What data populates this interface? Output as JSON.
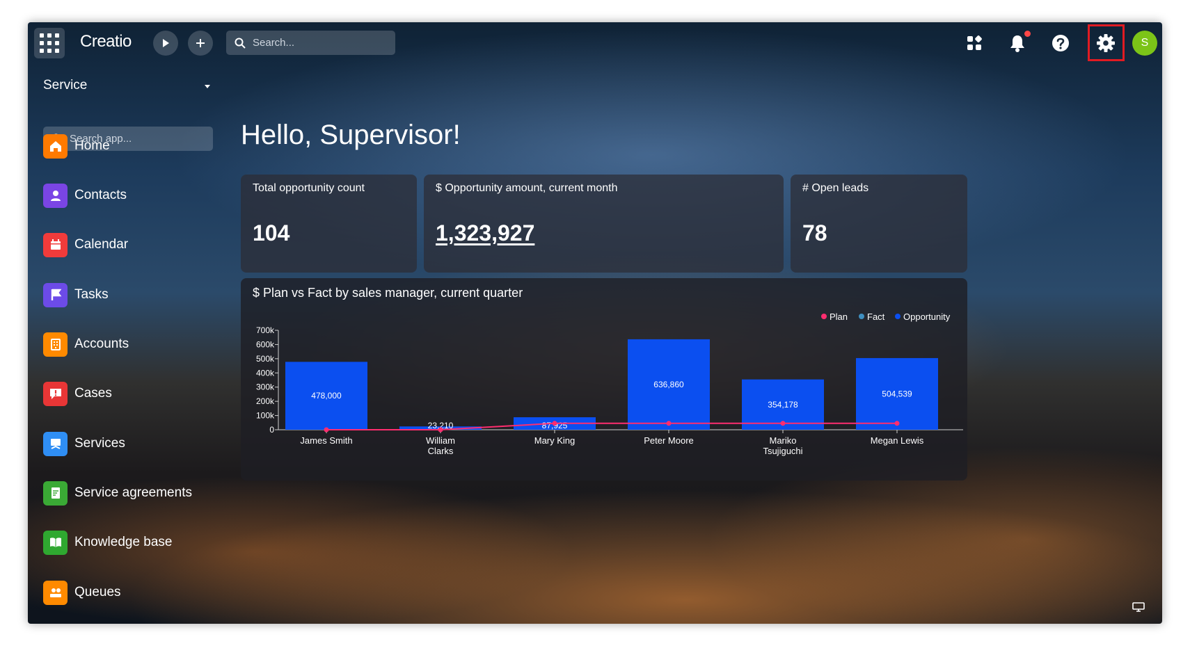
{
  "topbar": {
    "logo": "Creatio",
    "search_placeholder": "Search...",
    "avatar_initial": "S"
  },
  "sidebar": {
    "workspace": "Service",
    "search_placeholder": "Search app...",
    "items": [
      {
        "label": "Home",
        "icon": "home-icon",
        "color": "#ff7a00"
      },
      {
        "label": "Contacts",
        "icon": "person-icon",
        "color": "#7a45e5"
      },
      {
        "label": "Calendar",
        "icon": "calendar-icon",
        "color": "#f13b3b"
      },
      {
        "label": "Tasks",
        "icon": "flag-icon",
        "color": "#6c4be8"
      },
      {
        "label": "Accounts",
        "icon": "building-icon",
        "color": "#ff8a00"
      },
      {
        "label": "Cases",
        "icon": "case-alert-icon",
        "color": "#e83636"
      },
      {
        "label": "Services",
        "icon": "service-icon",
        "color": "#2f8ef4"
      },
      {
        "label": "Service agreements",
        "icon": "agreement-icon",
        "color": "#3aa935"
      },
      {
        "label": "Knowledge base",
        "icon": "book-icon",
        "color": "#2fa830"
      },
      {
        "label": "Queues",
        "icon": "queue-icon",
        "color": "#ff8a00"
      }
    ]
  },
  "main": {
    "greeting": "Hello, Supervisor!",
    "cards": [
      {
        "title": "Total opportunity count",
        "value": "104"
      },
      {
        "title": "$ Opportunity amount, current month",
        "value": "1,323,927"
      },
      {
        "title": "# Open leads",
        "value": "78"
      }
    ]
  },
  "chart_data": {
    "type": "bar",
    "title": "$ Plan vs Fact by sales manager, current quarter",
    "categories": [
      "James Smith",
      "William Clarks",
      "Mary King",
      "Peter Moore",
      "Mariko Tsujiguchi",
      "Megan Lewis"
    ],
    "category_lines": [
      [
        "James Smith"
      ],
      [
        "William",
        "Clarks"
      ],
      [
        "Mary King"
      ],
      [
        "Peter Moore"
      ],
      [
        "Mariko",
        "Tsujiguchi"
      ],
      [
        "Megan Lewis"
      ]
    ],
    "ylim": [
      0,
      700000
    ],
    "yticks": [
      "0",
      "100k",
      "200k",
      "300k",
      "400k",
      "500k",
      "600k",
      "700k"
    ],
    "legend": [
      "Plan",
      "Fact",
      "Opportunity"
    ],
    "legend_position": "top-right",
    "series": [
      {
        "name": "Opportunity",
        "color": "#0b4ff0",
        "kind": "bar",
        "values": [
          478000,
          23210,
          87925,
          636860,
          354178,
          504539
        ],
        "labels": [
          "478,000",
          "23,210",
          "87,925",
          "636,860",
          "354,178",
          "504,539"
        ]
      },
      {
        "name": "Plan",
        "color": "#ff2d6f",
        "kind": "line",
        "values": [
          0,
          0,
          45000,
          45000,
          45000,
          45000
        ]
      },
      {
        "name": "Fact",
        "color": "#3f8fc0",
        "kind": "line",
        "values": []
      }
    ]
  }
}
